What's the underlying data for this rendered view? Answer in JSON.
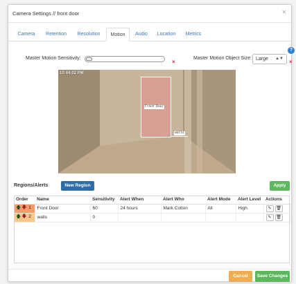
{
  "dialog": {
    "title": "Camera Settings // front door",
    "close_symbol": "×"
  },
  "tabs": [
    {
      "label": "Camera",
      "active": false
    },
    {
      "label": "Retention",
      "active": false
    },
    {
      "label": "Resolution",
      "active": false
    },
    {
      "label": "Motion",
      "active": true
    },
    {
      "label": "Audio",
      "active": false
    },
    {
      "label": "Location",
      "active": false
    },
    {
      "label": "Metrics",
      "active": false
    }
  ],
  "motion": {
    "sensitivity_label": "Master Motion Sensitivity:",
    "sensitivity_value_fraction": 0.0,
    "object_size_label": "Master Motion Object Size:",
    "object_size_value": "Large",
    "clear_symbol": "×",
    "help_symbol": "?"
  },
  "camera_view": {
    "timestamp": "10:44:02 PM",
    "regions": [
      {
        "name": "Front Door",
        "color": "#e58f8f"
      },
      {
        "name": "walls",
        "color": "#ffffff"
      }
    ]
  },
  "regions_panel": {
    "title": "Regions/Alerts",
    "new_region_label": "New Region",
    "apply_label": "Apply",
    "columns": [
      "Order",
      "Name",
      "Sensitivity",
      "Alert When",
      "Alert Who",
      "Alert Mode",
      "Alert Level",
      "Actions"
    ],
    "rows": [
      {
        "order": "1",
        "name": "Front Door",
        "sensitivity": "60",
        "alert_when": "24 hours",
        "alert_who": "Mark Cotton",
        "alert_mode": "All",
        "alert_level": "High"
      },
      {
        "order": "2",
        "name": "walls",
        "sensitivity": "0",
        "alert_when": "",
        "alert_who": "",
        "alert_mode": "",
        "alert_level": ""
      }
    ]
  },
  "footer": {
    "cancel_label": "Cancel",
    "save_label": "Save Changes"
  },
  "colors": {
    "link_blue": "#3a78b5",
    "primary_blue": "#2d6ea8",
    "success_green": "#5cb85c",
    "warning_orange": "#f0ad4e",
    "error_red": "#d9262c"
  }
}
